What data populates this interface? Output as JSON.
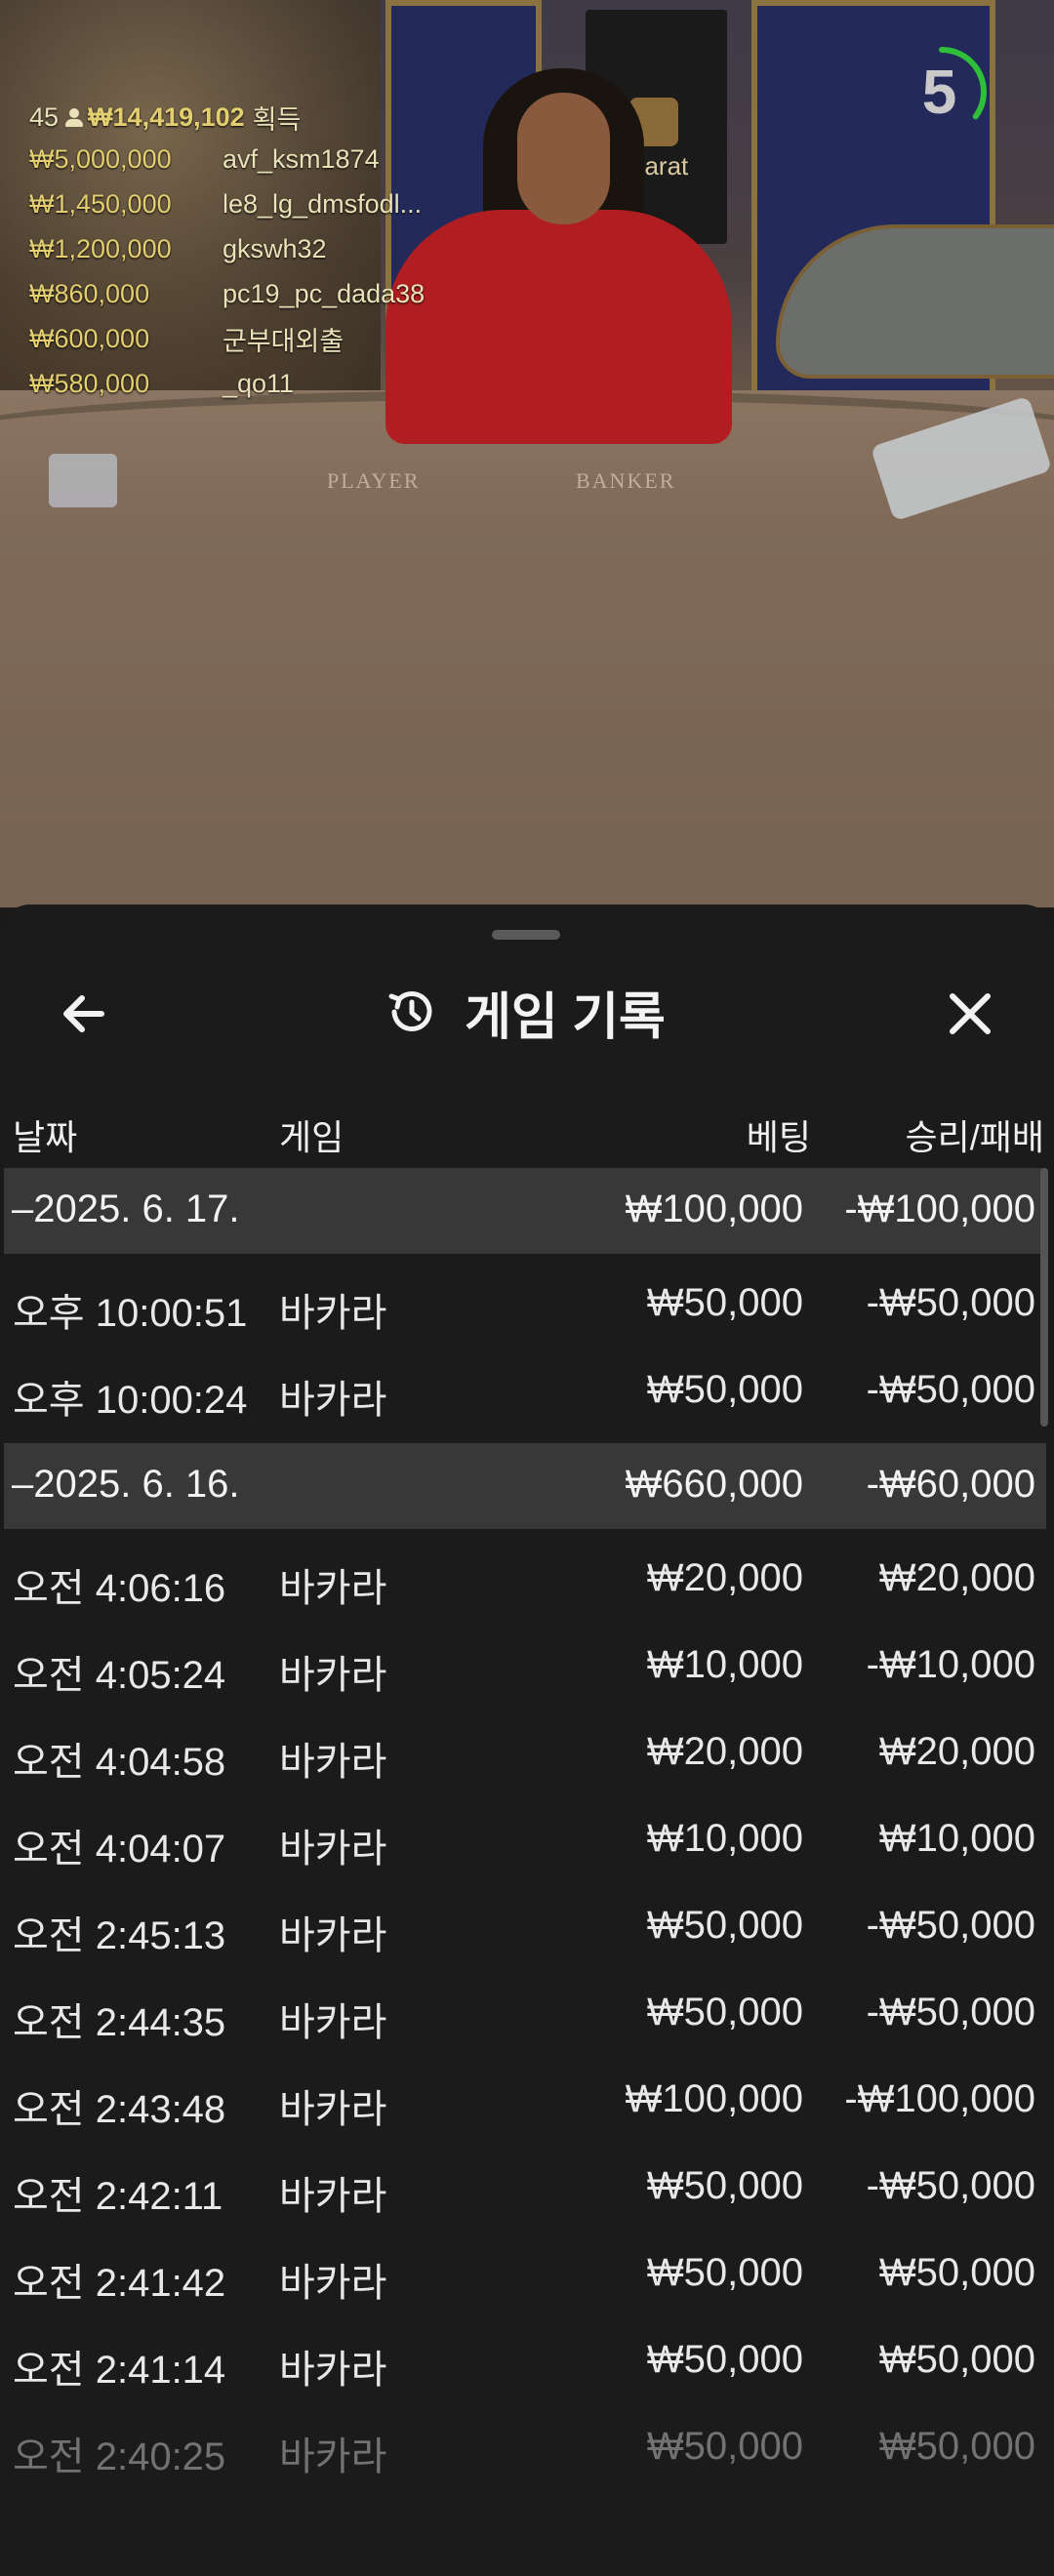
{
  "live": {
    "player_count": "45",
    "total_won": "₩14,419,102",
    "total_suffix": "획득",
    "winners": [
      {
        "amount": "₩5,000,000",
        "name": "avf_ksm1874"
      },
      {
        "amount": "₩1,450,000",
        "name": "le8_lg_dmsfodl..."
      },
      {
        "amount": "₩1,200,000",
        "name": "gkswh32"
      },
      {
        "amount": "₩860,000",
        "name": "pc19_pc_dada38"
      },
      {
        "amount": "₩600,000",
        "name": "군부대외출"
      },
      {
        "amount": "₩580,000",
        "name": "_qo11"
      }
    ],
    "table_labels": {
      "player": "PLAYER",
      "banker": "BANKER"
    },
    "logo_text": "accarat",
    "countdown": "5",
    "countdown_progress": 0.35
  },
  "sheet": {
    "title": "게임 기록",
    "icons": {
      "back": "back-arrow-icon",
      "history": "history-icon",
      "close": "close-icon"
    },
    "columns": {
      "date": "날짜",
      "game": "게임",
      "bet": "베팅",
      "win_loss": "승리/패배"
    },
    "groups": [
      {
        "date": "–2025. 6. 17.",
        "bet": "₩100,000",
        "win_loss": "-₩100,000",
        "rows": [
          {
            "time": "오후 10:00:51",
            "game": "바카라",
            "bet": "₩50,000",
            "win_loss": "-₩50,000"
          },
          {
            "time": "오후 10:00:24",
            "game": "바카라",
            "bet": "₩50,000",
            "win_loss": "-₩50,000"
          }
        ]
      },
      {
        "date": "–2025. 6. 16.",
        "bet": "₩660,000",
        "win_loss": "-₩60,000",
        "rows": [
          {
            "time": "오전 4:06:16",
            "game": "바카라",
            "bet": "₩20,000",
            "win_loss": "₩20,000"
          },
          {
            "time": "오전 4:05:24",
            "game": "바카라",
            "bet": "₩10,000",
            "win_loss": "-₩10,000"
          },
          {
            "time": "오전 4:04:58",
            "game": "바카라",
            "bet": "₩20,000",
            "win_loss": "₩20,000"
          },
          {
            "time": "오전 4:04:07",
            "game": "바카라",
            "bet": "₩10,000",
            "win_loss": "₩10,000"
          },
          {
            "time": "오전 2:45:13",
            "game": "바카라",
            "bet": "₩50,000",
            "win_loss": "-₩50,000"
          },
          {
            "time": "오전 2:44:35",
            "game": "바카라",
            "bet": "₩50,000",
            "win_loss": "-₩50,000"
          },
          {
            "time": "오전 2:43:48",
            "game": "바카라",
            "bet": "₩100,000",
            "win_loss": "-₩100,000"
          },
          {
            "time": "오전 2:42:11",
            "game": "바카라",
            "bet": "₩50,000",
            "win_loss": "-₩50,000"
          },
          {
            "time": "오전 2:41:42",
            "game": "바카라",
            "bet": "₩50,000",
            "win_loss": "₩50,000"
          },
          {
            "time": "오전 2:41:14",
            "game": "바카라",
            "bet": "₩50,000",
            "win_loss": "₩50,000"
          },
          {
            "time": "오전 2:40:25",
            "game": "바카라",
            "bet": "₩50,000",
            "win_loss": "₩50,000"
          }
        ]
      }
    ]
  }
}
